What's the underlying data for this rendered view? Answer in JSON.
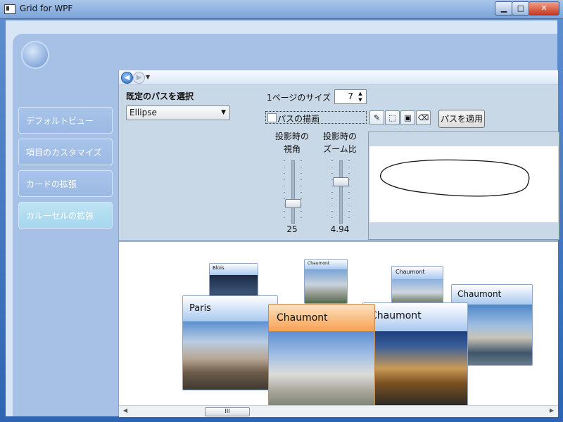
{
  "window": {
    "title": "Grid for WPF",
    "minimize_glyph": "▁",
    "maximize_glyph": "□",
    "close_glyph": "✕"
  },
  "sidebar": {
    "items": [
      {
        "label": "デフォルトビュー"
      },
      {
        "label": "項目のカスタマイズ"
      },
      {
        "label": "カードの拡張"
      },
      {
        "label": "カルーセルの拡張",
        "active": true
      }
    ]
  },
  "navbar": {
    "back_icon": "back-arrow-icon",
    "forward_icon": "forward-arrow-icon"
  },
  "controls": {
    "preset_label": "既定のパスを選択",
    "preset_value": "Ellipse",
    "page_size_label": "1ページのサイズ",
    "page_size_value": "7",
    "draw_path_label": "パスの描画",
    "draw_path_checked": false,
    "apply_label": "パスを適用",
    "tools": [
      "brush-icon",
      "select-icon",
      "stroke-icon",
      "eraser-icon"
    ],
    "slider_angle": {
      "label_line1": "投影時の",
      "label_line2": "視角",
      "value": "25"
    },
    "slider_zoom": {
      "label_line1": "投影時の",
      "label_line2": "ズーム比",
      "value": "4.94"
    }
  },
  "carousel": {
    "cards": [
      {
        "title": "Blois"
      },
      {
        "title": "Chaumont"
      },
      {
        "title": "Chaumont"
      },
      {
        "title": "Chaumont"
      },
      {
        "title": "Paris"
      },
      {
        "title": "Chaumont"
      },
      {
        "title": "Chaumont",
        "selected": true
      }
    ]
  },
  "scrollbar": {
    "grip": "III"
  },
  "colors": {
    "accent": "#a6c0e6",
    "selected_card": "#f5a252",
    "window_frame": "#3a73b8"
  }
}
